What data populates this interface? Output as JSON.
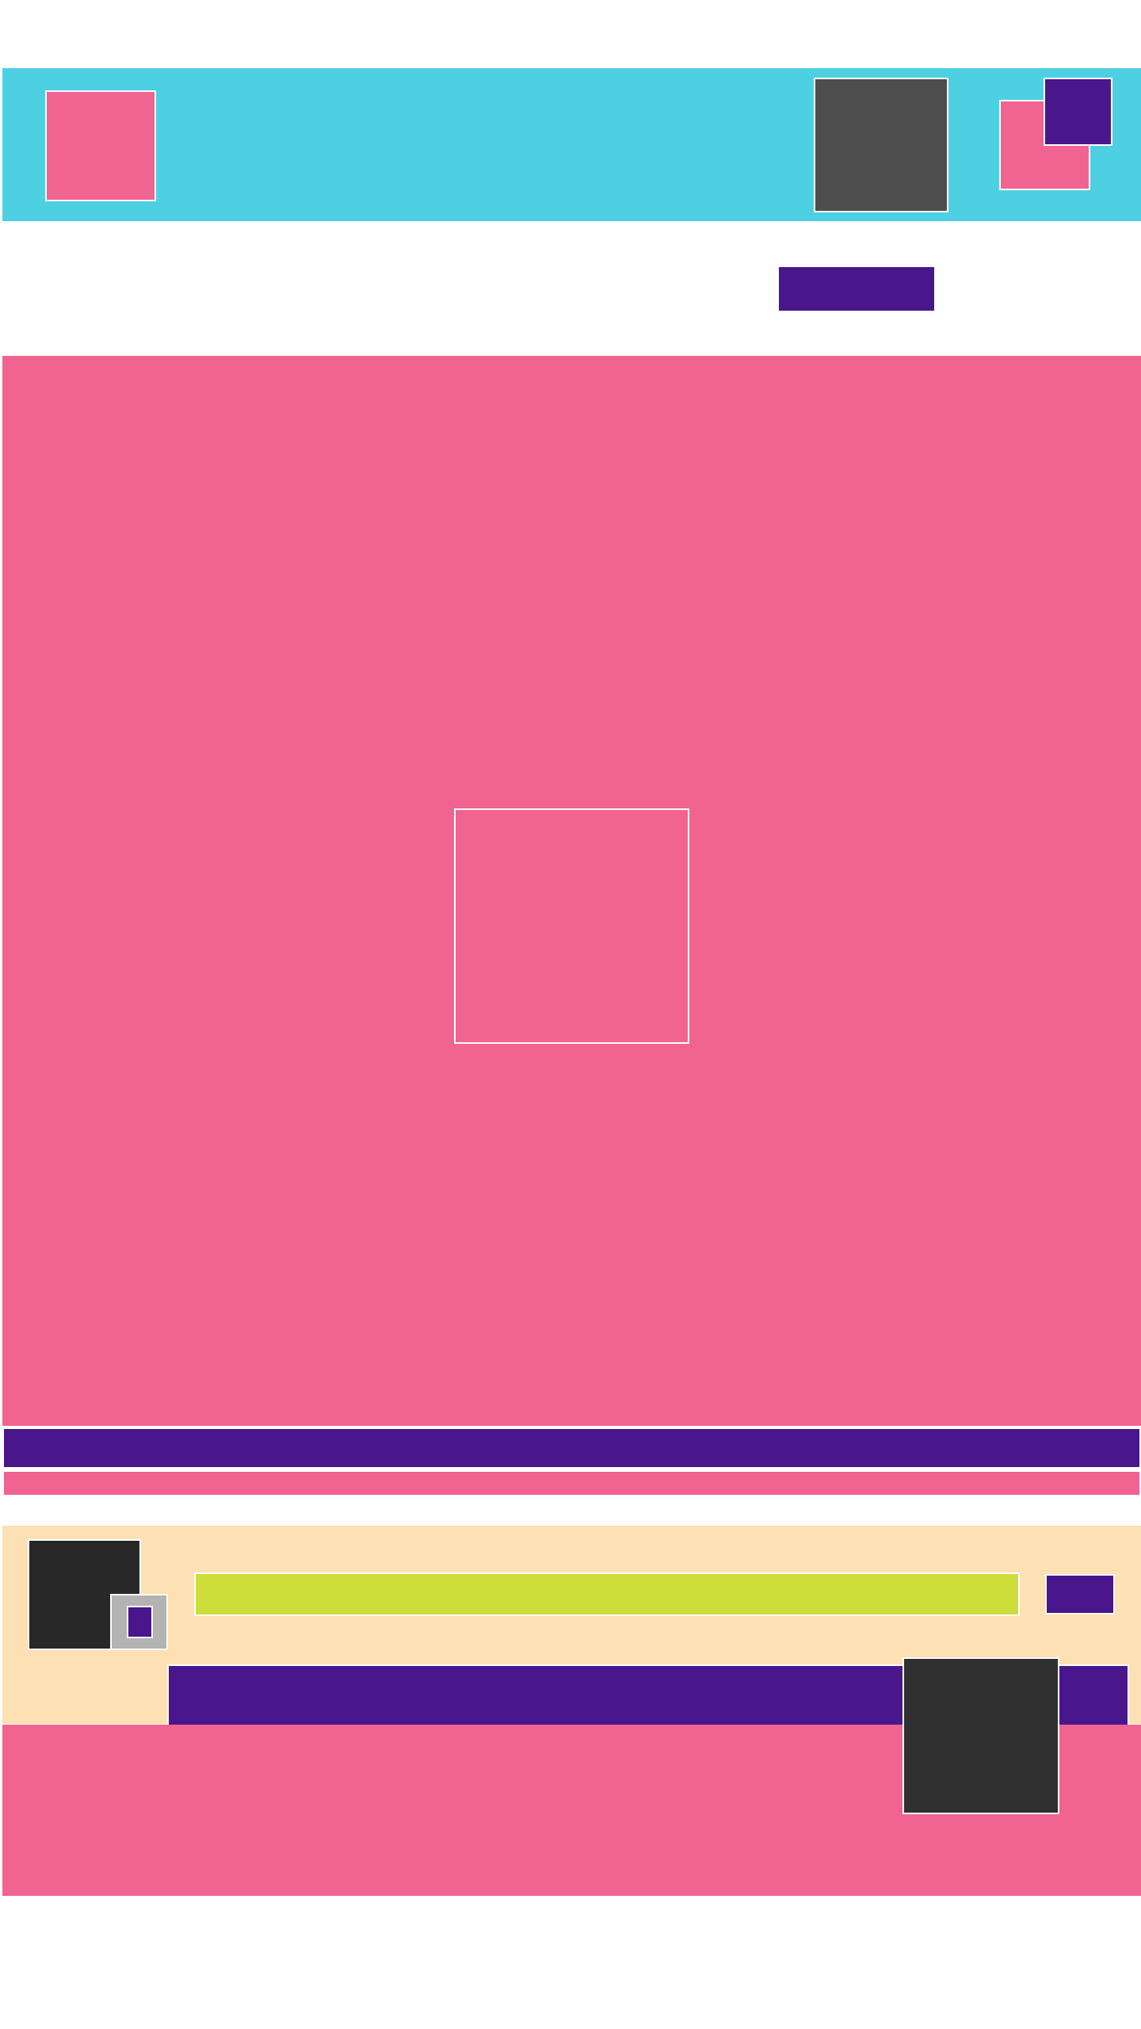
{
  "colors": {
    "header_bg": "#4ed0e3",
    "accent_pink": "#f16391",
    "accent_purple": "#4a168b",
    "tile_gray": "#4d4d4d",
    "panel_bg": "#fde0b3",
    "input_lime": "#cddd3a",
    "avatar_dark": "#282828",
    "badge_gray": "#b3b3b3",
    "tile_dark": "#303030",
    "page_bg": "#fefefe",
    "outline_white": "#ffffff"
  },
  "header": {
    "logo_icon": "logo-block-icon",
    "tile_icon": "tile-block-icon",
    "stack_icon": "stacked-squares-icon"
  },
  "action": {
    "label": ""
  },
  "hero": {
    "frame_icon": "image-frame-icon"
  },
  "footer": {
    "search_placeholder": "",
    "send_label": ""
  }
}
